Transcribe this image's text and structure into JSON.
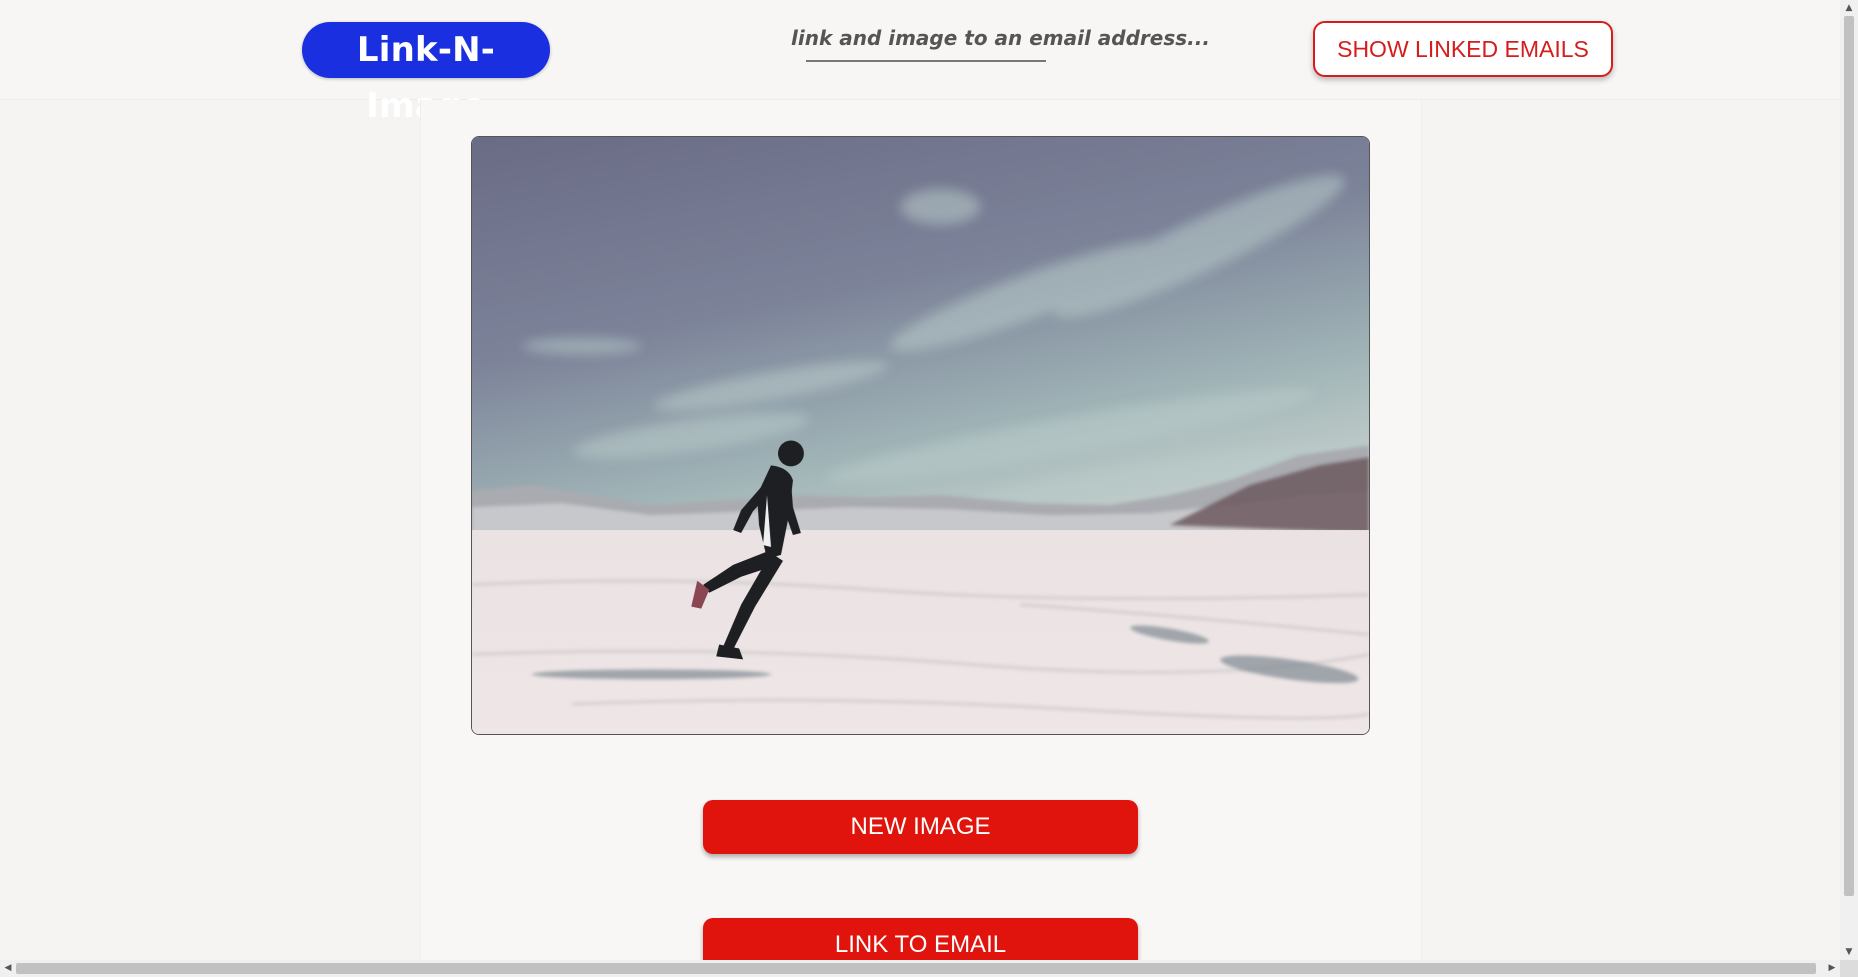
{
  "header": {
    "brand": "Link-N-Image",
    "tagline": "link and image to an email address...",
    "show_emails_label": "SHOW LINKED EMAILS"
  },
  "main": {
    "image": {
      "icon": "photo-of-person-running-on-snowfield"
    },
    "new_image_label": "NEW IMAGE",
    "link_email_label": "LINK TO EMAIL"
  },
  "colors": {
    "brand": "#1a2fe0",
    "accent": "#e0130d",
    "outline_button": "#d61d1d",
    "background": "#f5f4f2"
  },
  "scrollbars": {
    "up_icon": "▲",
    "down_icon": "▼",
    "left_icon": "◀",
    "right_icon": "▶"
  }
}
